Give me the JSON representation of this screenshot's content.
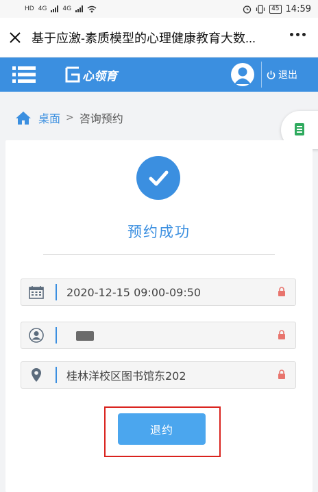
{
  "status_bar": {
    "left_labels": [
      "HD",
      "HD",
      "4G",
      "4G"
    ],
    "battery": "45",
    "time": "14:59"
  },
  "wechat": {
    "title": "基于应激-素质模型的心理健康教育大数..."
  },
  "app_header": {
    "logo_text": "心领育",
    "logout_label": "退出"
  },
  "breadcrumb": {
    "home": "桌面",
    "separator": ">",
    "current": "咨询预约"
  },
  "result": {
    "title": "预约成功"
  },
  "fields": {
    "time": "2020-12-15 09:00-09:50",
    "location": "桂林洋校区图书馆东202"
  },
  "actions": {
    "cancel_label": "退约"
  },
  "colors": {
    "primary": "#3b8fe0",
    "button": "#4ba6ee",
    "highlight_border": "#d9221d",
    "lock": "#e8746d"
  }
}
